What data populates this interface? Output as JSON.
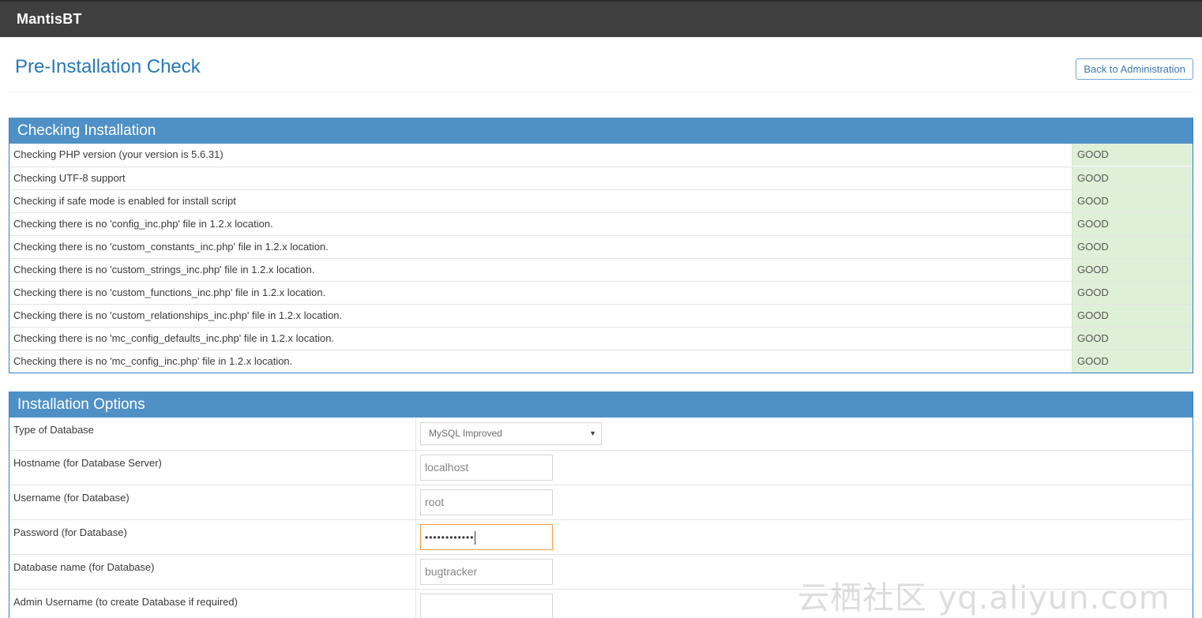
{
  "navbar": {
    "brand": "MantisBT"
  },
  "header": {
    "title": "Pre-Installation Check",
    "back_button": "Back to Administration"
  },
  "checking": {
    "title": "Checking Installation",
    "rows": [
      {
        "label": "Checking PHP version (your version is 5.6.31)",
        "status": "GOOD"
      },
      {
        "label": "Checking UTF-8 support",
        "status": "GOOD"
      },
      {
        "label": "Checking if safe mode is enabled for install script",
        "status": "GOOD"
      },
      {
        "label": "Checking there is no 'config_inc.php' file in 1.2.x location.",
        "status": "GOOD"
      },
      {
        "label": "Checking there is no 'custom_constants_inc.php' file in 1.2.x location.",
        "status": "GOOD"
      },
      {
        "label": "Checking there is no 'custom_strings_inc.php' file in 1.2.x location.",
        "status": "GOOD"
      },
      {
        "label": "Checking there is no 'custom_functions_inc.php' file in 1.2.x location.",
        "status": "GOOD"
      },
      {
        "label": "Checking there is no 'custom_relationships_inc.php' file in 1.2.x location.",
        "status": "GOOD"
      },
      {
        "label": "Checking there is no 'mc_config_defaults_inc.php' file in 1.2.x location.",
        "status": "GOOD"
      },
      {
        "label": "Checking there is no 'mc_config_inc.php' file in 1.2.x location.",
        "status": "GOOD"
      }
    ],
    "good_color": "#dff0d8"
  },
  "options": {
    "title": "Installation Options",
    "db_type": {
      "label": "Type of Database",
      "value": "MySQL Improved"
    },
    "hostname": {
      "label": "Hostname (for Database Server)",
      "value": "localhost"
    },
    "username": {
      "label": "Username (for Database)",
      "value": "root"
    },
    "password": {
      "label": "Password (for Database)",
      "value": "••••••••••••"
    },
    "db_name": {
      "label": "Database name (for Database)",
      "value": "bugtracker"
    },
    "admin_username": {
      "label": "Admin Username (to create Database if required)",
      "value": ""
    }
  },
  "watermark": "云栖社区 yq.aliyun.com",
  "colors": {
    "navbar": "#3f3f3f",
    "widget_header": "#4f90c6",
    "title": "#2679b5",
    "focus_border": "#f59942"
  }
}
